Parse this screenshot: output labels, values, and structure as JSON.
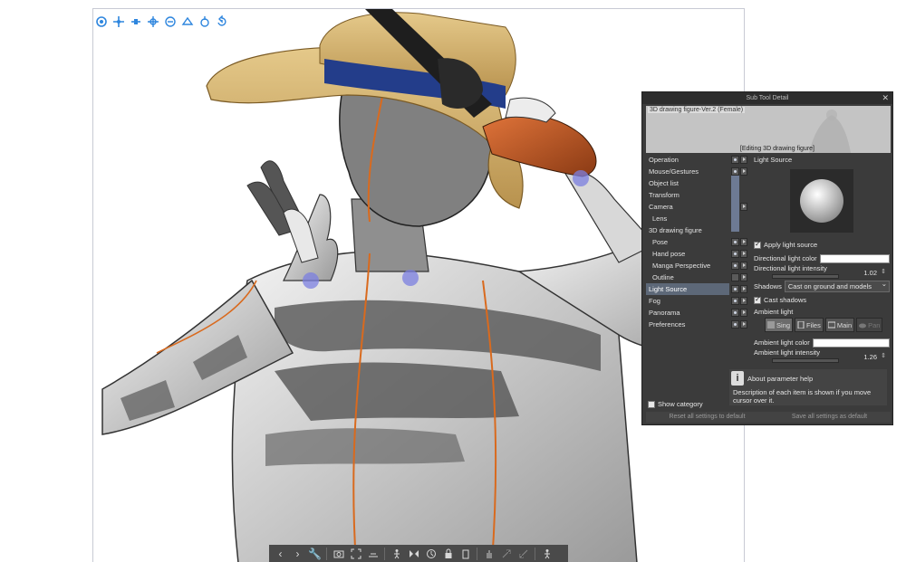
{
  "top_toolbar": {
    "icons": [
      "camera-rotate-icon",
      "camera-pan-icon",
      "camera-zoom-icon",
      "object-move-icon",
      "object-rotate-x-icon",
      "object-rotate-y-icon",
      "object-rotate-z-icon",
      "undo-rotate-icon"
    ],
    "accent": "#2e86de"
  },
  "dialog": {
    "title": "Sub Tool Detail",
    "close": "✕",
    "preview_name": "3D drawing figure-Ver.2 (Female)",
    "preview_caption": "[Editing 3D drawing figure]",
    "categories": [
      {
        "label": "Operation",
        "sub": false
      },
      {
        "label": "Mouse/Gestures",
        "sub": false
      },
      {
        "label": "Object list",
        "sub": false
      },
      {
        "label": "Transform",
        "sub": false
      },
      {
        "label": "Camera",
        "sub": false
      },
      {
        "label": "Lens",
        "sub": true
      },
      {
        "label": "3D drawing figure",
        "sub": false
      },
      {
        "label": "Pose",
        "sub": true
      },
      {
        "label": "Hand pose",
        "sub": true
      },
      {
        "label": "Manga Perspective",
        "sub": true
      },
      {
        "label": "Outline",
        "sub": true
      },
      {
        "label": "Light Source",
        "sub": false,
        "active": true
      },
      {
        "label": "Fog",
        "sub": false
      },
      {
        "label": "Panorama",
        "sub": false
      },
      {
        "label": "Preferences",
        "sub": false
      }
    ],
    "section_title": "Light Source",
    "apply_light_source": "Apply light source",
    "directional_light_color": "Directional light color",
    "directional_light_intensity": "Directional light intensity",
    "directional_light_intensity_value": "1.02",
    "shadows_label": "Shadows",
    "shadows_value": "Cast on ground and models",
    "cast_shadows": "Cast shadows",
    "ambient_light": "Ambient light",
    "ambient_buttons": [
      "Sing",
      "Files",
      "Main",
      "Pan"
    ],
    "ambient_light_color": "Ambient light color",
    "ambient_light_intensity": "Ambient light intensity",
    "ambient_light_intensity_value": "1.26",
    "help_icon": "i",
    "help_title": "About parameter help",
    "help_text": "Description of each item is shown if you move cursor over it.",
    "show_category": "Show category",
    "reset_all": "Reset all settings to default",
    "save_all": "Save all settings as default",
    "colors": {
      "active": "#5d6878",
      "panel": "#3b3b3b",
      "handle": "#7b7fe0"
    }
  },
  "bottom_toolbar": {
    "icons": [
      "prev-icon",
      "next-icon",
      "wrench-icon",
      "camera-icon",
      "fit-icon",
      "ground-icon",
      "pose-icon",
      "flip-icon",
      "reset-pose-icon",
      "lock-icon",
      "body-type-icon",
      "hand-icon",
      "expand-icon",
      "collapse-icon",
      "figure-icon"
    ],
    "prev": "‹",
    "next": "›"
  }
}
